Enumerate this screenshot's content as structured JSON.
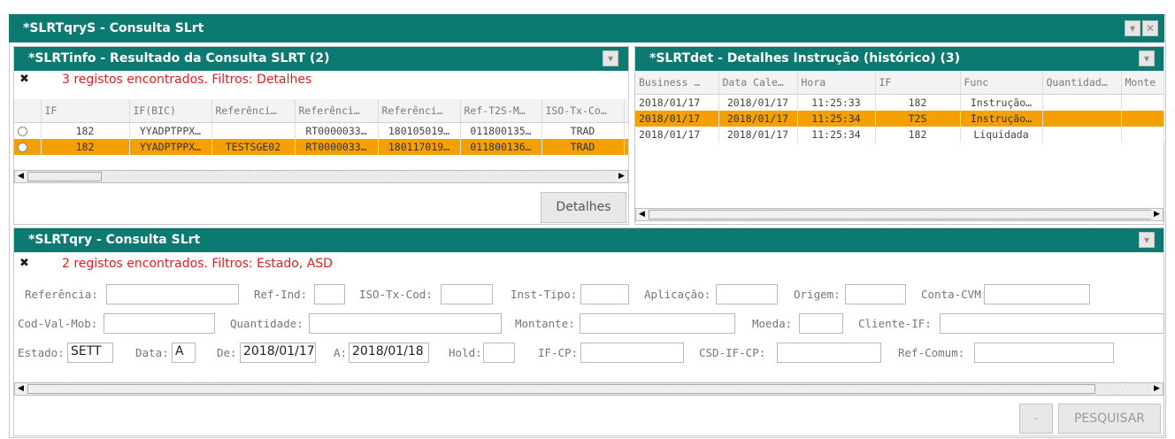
{
  "outer": {
    "title": "*SLRTqryS - Consulta SLrt",
    "min_icon": "chevron-down-icon",
    "close_icon": "close-icon"
  },
  "info": {
    "title": "*SLRTinfo - Resultado da Consulta SLRT (2)",
    "status": "3 registos encontrados. Filtros: Detalhes",
    "columns": [
      "",
      "IF",
      "IF(BIC)",
      "Referênci…",
      "Referênci…",
      "Referênci…",
      "Ref-T2S-M…",
      "ISO-Tx-Co…",
      "I"
    ],
    "rows": [
      [
        "",
        "182",
        "YYADPTPPX…",
        "",
        "RT0000033…",
        "180105019…",
        "011800135…",
        "TRAD",
        ""
      ],
      [
        "",
        "182",
        "YYADPTPPX…",
        "TESTSGE02",
        "RT0000033…",
        "180117019…",
        "011800136…",
        "TRAD",
        ""
      ]
    ],
    "selected_row": 1,
    "detalhes_label": "Detalhes"
  },
  "det": {
    "title": "*SLRTdet - Detalhes Instrução (histórico) (3)",
    "columns": [
      "Business …",
      "Data Cale…",
      "Hora",
      "IF",
      "Func",
      "Quantidad…",
      "Monte"
    ],
    "rows": [
      [
        "2018/01/17",
        "2018/01/17",
        "11:25:33",
        "182",
        "Instrução…",
        "",
        ""
      ],
      [
        "2018/01/17",
        "2018/01/17",
        "11:25:34",
        "T2S",
        "Instrução…",
        "",
        ""
      ],
      [
        "2018/01/17",
        "2018/01/17",
        "11:25:34",
        "182",
        "Liquidada",
        "",
        ""
      ]
    ],
    "selected_row": 1
  },
  "qry": {
    "title": "*SLRTqry - Consulta SLrt",
    "status": "2 registos encontrados. Filtros:  Estado, ASD",
    "fields": {
      "referencia": {
        "label": "Referência:",
        "value": ""
      },
      "ref_ind": {
        "label": "Ref-Ind:",
        "value": ""
      },
      "iso_tx_cod": {
        "label": "ISO-Tx-Cod:",
        "value": ""
      },
      "inst_tipo": {
        "label": "Inst-Tipo:",
        "value": ""
      },
      "aplicacao": {
        "label": "Aplicação:",
        "value": ""
      },
      "origem": {
        "label": "Origem:",
        "value": ""
      },
      "conta_cvm": {
        "label": "Conta-CVM:",
        "value": ""
      },
      "cod_val_mob": {
        "label": "Cod-Val-Mob:",
        "value": ""
      },
      "quantidade": {
        "label": "Quantidade:",
        "value": ""
      },
      "montante": {
        "label": "Montante:",
        "value": ""
      },
      "moeda": {
        "label": "Moeda:",
        "value": ""
      },
      "cliente_if": {
        "label": "Cliente-IF:",
        "value": ""
      },
      "estado": {
        "label": "Estado:",
        "value": "SETT"
      },
      "data": {
        "label": "Data:",
        "value": "A"
      },
      "de": {
        "label": "De:",
        "value": "2018/01/17"
      },
      "a": {
        "label": "A:",
        "value": "2018/01/18"
      },
      "hold": {
        "label": "Hold:",
        "value": ""
      },
      "if_cp": {
        "label": "IF-CP:",
        "value": ""
      },
      "csd_if_cp": {
        "label": "CSD-IF-CP:",
        "value": ""
      },
      "ref_comum": {
        "label": "Ref-Comum:",
        "value": ""
      }
    },
    "minus_label": "-",
    "pesquisar_label": "PESQUISAR"
  }
}
